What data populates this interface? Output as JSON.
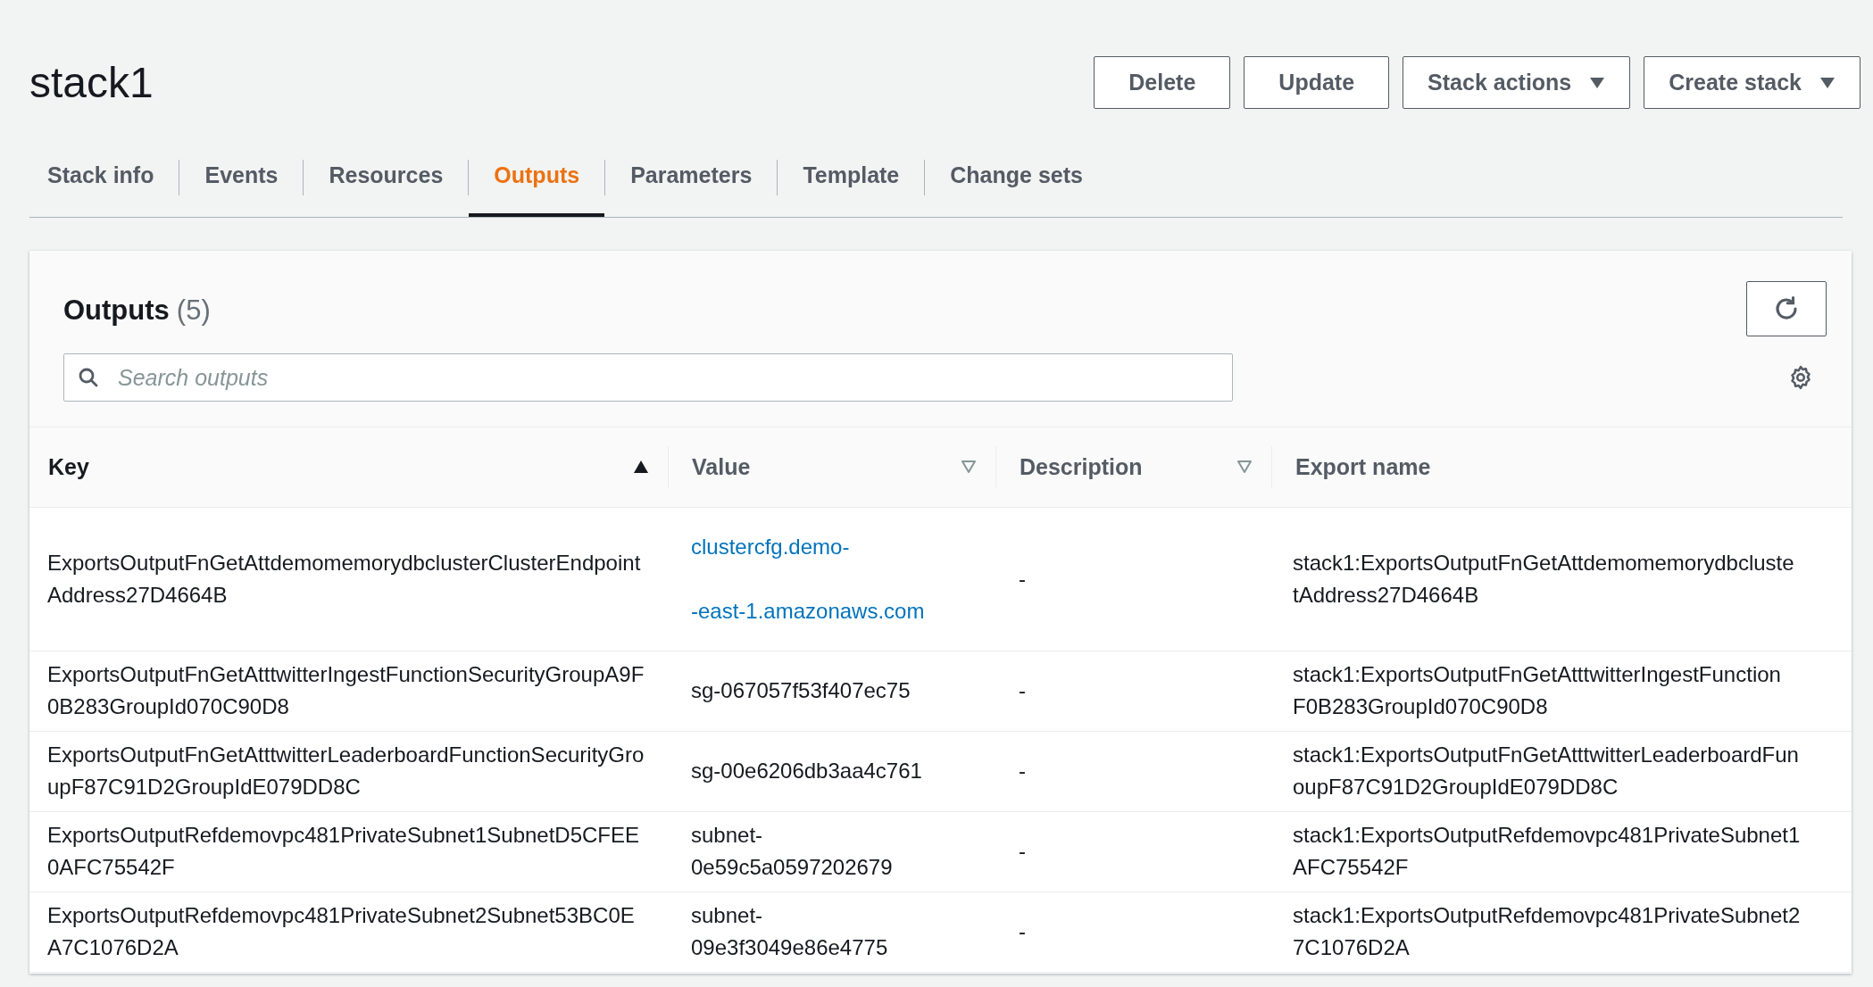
{
  "title": "stack1",
  "actions": [
    {
      "label": "Delete",
      "dropdown": false
    },
    {
      "label": "Update",
      "dropdown": false
    },
    {
      "label": "Stack actions",
      "dropdown": true
    },
    {
      "label": "Create stack",
      "dropdown": true
    }
  ],
  "tabs": [
    {
      "label": "Stack info",
      "selected": false
    },
    {
      "label": "Events",
      "selected": false
    },
    {
      "label": "Resources",
      "selected": false
    },
    {
      "label": "Outputs",
      "selected": true
    },
    {
      "label": "Parameters",
      "selected": false
    },
    {
      "label": "Template",
      "selected": false
    },
    {
      "label": "Change sets",
      "selected": false
    }
  ],
  "panel": {
    "heading": "Outputs",
    "count": "(5)",
    "search": {
      "placeholder": "Search outputs"
    }
  },
  "table": {
    "columns": [
      {
        "label": "Key",
        "sortable": true,
        "sorted": true
      },
      {
        "label": "Value",
        "sortable": true,
        "sorted": false
      },
      {
        "label": "Description",
        "sortable": true,
        "sorted": false
      },
      {
        "label": "Export name",
        "sortable": false
      }
    ],
    "rows": [
      {
        "key": "ExportsOutputFnGetAttdemomemorydbclusterClusterEndpointAddress27D4664B",
        "value": {
          "kind": "link",
          "lines": [
            "clustercfg.demo-",
            "-east-1.amazonaws.com"
          ]
        },
        "description": "-",
        "export_name": [
          "stack1:ExportsOutputFnGetAttdemomemorydbcluste",
          "tAddress27D4664B"
        ]
      },
      {
        "key": "ExportsOutputFnGetAtttwitterIngestFunctionSecurityGroupA9F0B283GroupId070C90D8",
        "value": {
          "kind": "text",
          "lines": [
            "sg-067057f53f407ec75"
          ]
        },
        "description": "-",
        "export_name": [
          "stack1:ExportsOutputFnGetAtttwitterIngestFunction",
          "F0B283GroupId070C90D8"
        ]
      },
      {
        "key": "ExportsOutputFnGetAtttwitterLeaderboardFunctionSecurityGroupF87C91D2GroupIdE079DD8C",
        "value": {
          "kind": "text",
          "lines": [
            "sg-00e6206db3aa4c761"
          ]
        },
        "description": "-",
        "export_name": [
          "stack1:ExportsOutputFnGetAtttwitterLeaderboardFun",
          "oupF87C91D2GroupIdE079DD8C"
        ]
      },
      {
        "key": "ExportsOutputRefdemovpc481PrivateSubnet1SubnetD5CFEE0AFC75542F",
        "value": {
          "kind": "text",
          "lines": [
            "subnet-",
            "0e59c5a0597202679"
          ]
        },
        "description": "-",
        "export_name": [
          "stack1:ExportsOutputRefdemovpc481PrivateSubnet1",
          "AFC75542F"
        ]
      },
      {
        "key": "ExportsOutputRefdemovpc481PrivateSubnet2Subnet53BC0EA7C1076D2A",
        "value": {
          "kind": "text",
          "lines": [
            "subnet-",
            "09e3f3049e86e4775"
          ]
        },
        "description": "-",
        "export_name": [
          "stack1:ExportsOutputRefdemovpc481PrivateSubnet2",
          "7C1076D2A"
        ]
      }
    ]
  }
}
